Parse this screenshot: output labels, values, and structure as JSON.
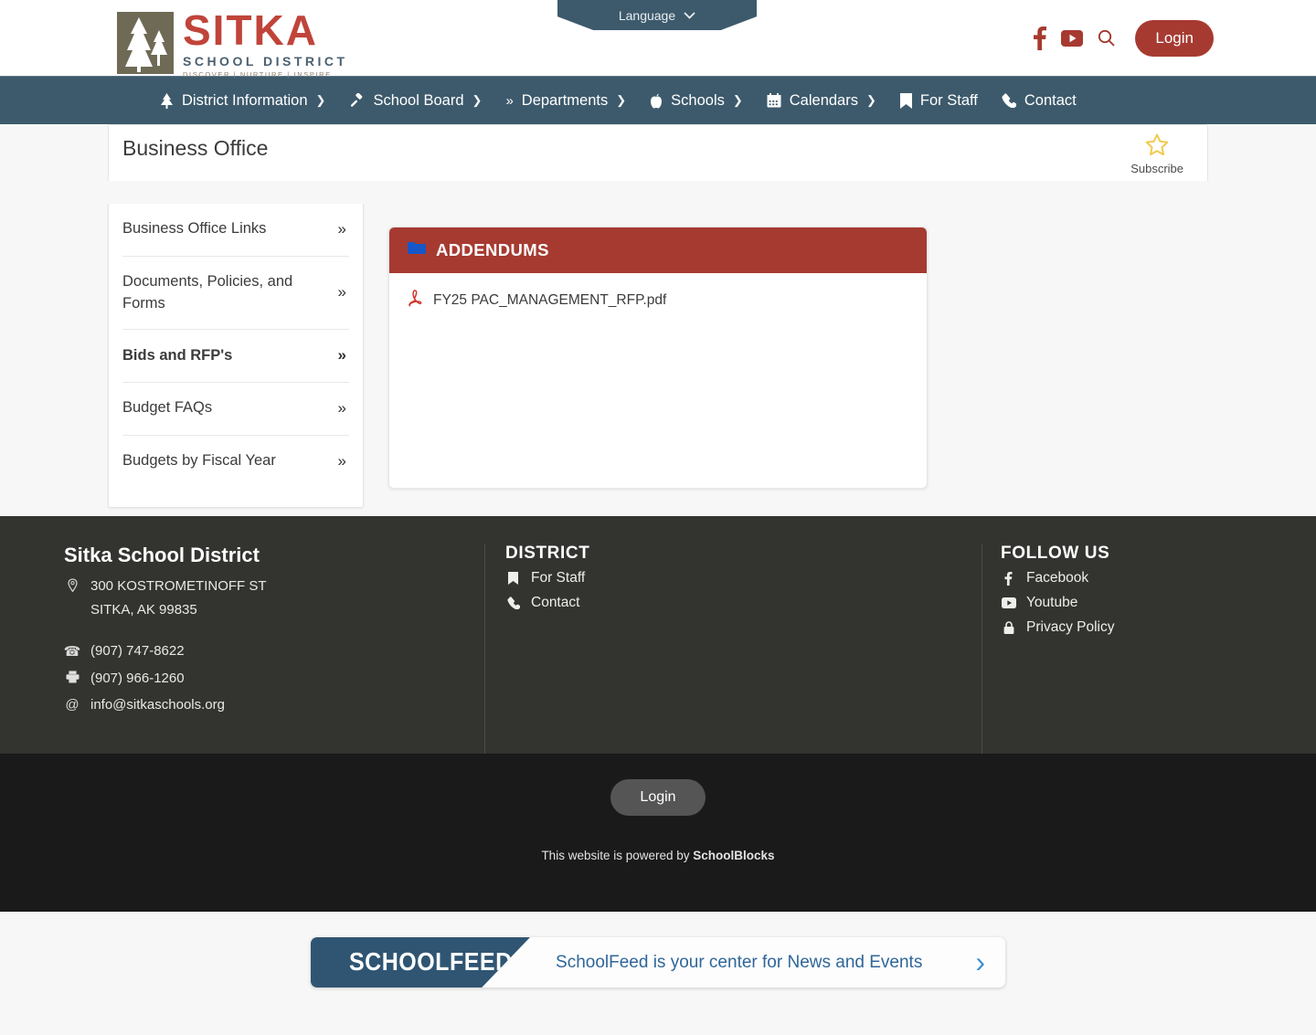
{
  "header": {
    "logo": {
      "name": "SITKA",
      "subtitle": "SCHOOL DISTRICT",
      "tagline": "DISCOVER  |  NURTURE  |  INSPIRE"
    },
    "language_label": "Language",
    "login_label": "Login",
    "icons": [
      "facebook-icon",
      "youtube-icon",
      "search-icon"
    ]
  },
  "nav": {
    "items": [
      {
        "label": "District Information",
        "icon": "tree-icon",
        "has_chevron": true
      },
      {
        "label": "School Board",
        "icon": "gavel-icon",
        "has_chevron": true
      },
      {
        "label": "Departments",
        "icon": "double-chevron-icon",
        "has_chevron": true
      },
      {
        "label": "Schools",
        "icon": "apple-icon",
        "has_chevron": true
      },
      {
        "label": "Calendars",
        "icon": "calendar-icon",
        "has_chevron": true
      },
      {
        "label": "For Staff",
        "icon": "bookmark-icon",
        "has_chevron": false
      },
      {
        "label": "Contact",
        "icon": "phone-icon",
        "has_chevron": false
      }
    ]
  },
  "page": {
    "title": "Business Office",
    "subscribe_label": "Subscribe"
  },
  "sidebar": {
    "items": [
      {
        "label": "Business Office Links",
        "active": false
      },
      {
        "label": "Documents, Policies, and Forms",
        "active": false
      },
      {
        "label": "Bids and RFP's",
        "active": true
      },
      {
        "label": "Budget FAQs",
        "active": false
      },
      {
        "label": "Budgets by Fiscal Year",
        "active": false
      }
    ]
  },
  "content": {
    "card_title": "ADDENDUMS",
    "card_icon": "folder-icon",
    "files": [
      {
        "name": "FY25 PAC_MANAGEMENT_RFP.pdf",
        "icon": "pdf-icon"
      }
    ]
  },
  "footer": {
    "district_name": "Sitka School District",
    "address_line1": "300 KOSTROMETINOFF ST",
    "address_line2": "SITKA, AK 99835",
    "phone": "(907) 747-8622",
    "fax": "(907) 966-1260",
    "email": "info@sitkaschools.org",
    "district_heading": "DISTRICT",
    "district_links": [
      {
        "label": "For Staff",
        "icon": "bookmark-icon"
      },
      {
        "label": "Contact",
        "icon": "phone-icon"
      }
    ],
    "follow_heading": "FOLLOW US",
    "follow_links": [
      {
        "label": "Facebook",
        "icon": "facebook-icon"
      },
      {
        "label": "Youtube",
        "icon": "youtube-icon"
      },
      {
        "label": "Privacy Policy",
        "icon": "lock-icon"
      }
    ],
    "login_label": "Login",
    "powered_prefix": "This website is powered by ",
    "powered_brand": "SchoolBlocks"
  },
  "banner": {
    "logo_text": "SCHOOLFEED",
    "message": "SchoolFeed is your center for News and Events",
    "arrow": "›"
  },
  "colors": {
    "brand_red": "#a63a31",
    "nav_blue": "#3d5a6c",
    "footer_dark": "#333430",
    "subfooter_dark": "#1a1a1a",
    "star_gold": "#f2c94c",
    "feed_blue": "#2f5573"
  }
}
